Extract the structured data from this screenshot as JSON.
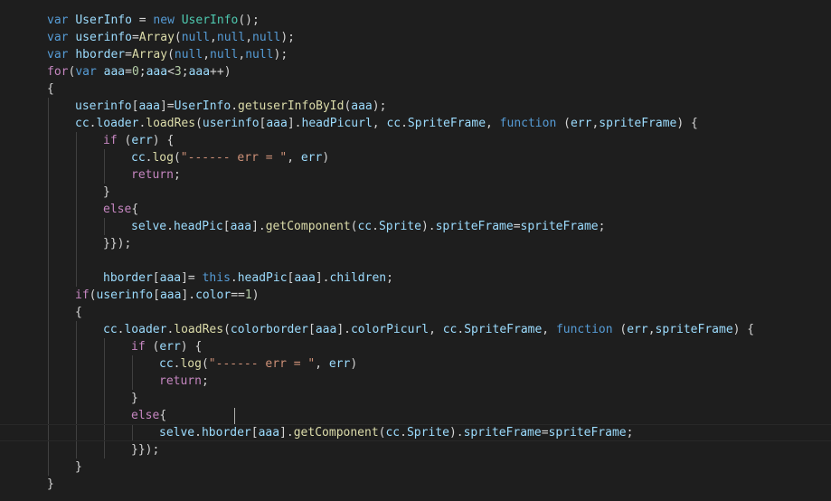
{
  "editor": {
    "theme_colors": {
      "background": "#1e1e1e",
      "keyword": "#569cd6",
      "control": "#c586c0",
      "variable": "#9cdcfe",
      "function": "#dcdcaa",
      "class": "#4ec9b0",
      "string": "#ce9178",
      "number": "#b5cea8",
      "punctuation": "#d4d4d4"
    },
    "cursor_line": 24,
    "lines": [
      {
        "indent": 0,
        "tokens": [
          [
            "kw",
            "var "
          ],
          [
            "vr",
            "UserInfo"
          ],
          [
            "pn",
            " = "
          ],
          [
            "kw",
            "new "
          ],
          [
            "cls",
            "UserInfo"
          ],
          [
            "pn",
            "();"
          ]
        ]
      },
      {
        "indent": 0,
        "tokens": [
          [
            "kw",
            "var "
          ],
          [
            "vr",
            "userinfo"
          ],
          [
            "pn",
            "="
          ],
          [
            "fn",
            "Array"
          ],
          [
            "pn",
            "("
          ],
          [
            "kw",
            "null"
          ],
          [
            "pn",
            ","
          ],
          [
            "kw",
            "null"
          ],
          [
            "pn",
            ","
          ],
          [
            "kw",
            "null"
          ],
          [
            "pn",
            ");"
          ]
        ]
      },
      {
        "indent": 0,
        "tokens": [
          [
            "kw",
            "var "
          ],
          [
            "vr",
            "hborder"
          ],
          [
            "pn",
            "="
          ],
          [
            "fn",
            "Array"
          ],
          [
            "pn",
            "("
          ],
          [
            "kw",
            "null"
          ],
          [
            "pn",
            ","
          ],
          [
            "kw",
            "null"
          ],
          [
            "pn",
            ","
          ],
          [
            "kw",
            "null"
          ],
          [
            "pn",
            ");"
          ]
        ]
      },
      {
        "indent": 0,
        "tokens": [
          [
            "ctl",
            "for"
          ],
          [
            "pn",
            "("
          ],
          [
            "kw",
            "var "
          ],
          [
            "vr",
            "aaa"
          ],
          [
            "pn",
            "="
          ],
          [
            "num",
            "0"
          ],
          [
            "pn",
            ";"
          ],
          [
            "vr",
            "aaa"
          ],
          [
            "pn",
            "<"
          ],
          [
            "num",
            "3"
          ],
          [
            "pn",
            ";"
          ],
          [
            "vr",
            "aaa"
          ],
          [
            "pn",
            "++)"
          ]
        ]
      },
      {
        "indent": 0,
        "tokens": [
          [
            "pn",
            "{"
          ]
        ]
      },
      {
        "indent": 1,
        "tokens": [
          [
            "vr",
            "userinfo"
          ],
          [
            "pn",
            "["
          ],
          [
            "vr",
            "aaa"
          ],
          [
            "pn",
            "]="
          ],
          [
            "vr",
            "UserInfo"
          ],
          [
            "pn",
            "."
          ],
          [
            "fn",
            "getuserInfoById"
          ],
          [
            "pn",
            "("
          ],
          [
            "vr",
            "aaa"
          ],
          [
            "pn",
            ");"
          ]
        ]
      },
      {
        "indent": 1,
        "tokens": [
          [
            "vr",
            "cc"
          ],
          [
            "pn",
            "."
          ],
          [
            "vr",
            "loader"
          ],
          [
            "pn",
            "."
          ],
          [
            "fn",
            "loadRes"
          ],
          [
            "pn",
            "("
          ],
          [
            "vr",
            "userinfo"
          ],
          [
            "pn",
            "["
          ],
          [
            "vr",
            "aaa"
          ],
          [
            "pn",
            "]."
          ],
          [
            "vr",
            "headPicurl"
          ],
          [
            "pn",
            ", "
          ],
          [
            "vr",
            "cc"
          ],
          [
            "pn",
            "."
          ],
          [
            "vr",
            "SpriteFrame"
          ],
          [
            "pn",
            ", "
          ],
          [
            "kw",
            "function"
          ],
          [
            "pn",
            " ("
          ],
          [
            "vr",
            "err"
          ],
          [
            "pn",
            ","
          ],
          [
            "vr",
            "spriteFrame"
          ],
          [
            "pn",
            ") {"
          ]
        ]
      },
      {
        "indent": 2,
        "tokens": [
          [
            "ctl",
            "if"
          ],
          [
            "pn",
            " ("
          ],
          [
            "vr",
            "err"
          ],
          [
            "pn",
            ") {"
          ]
        ]
      },
      {
        "indent": 3,
        "tokens": [
          [
            "vr",
            "cc"
          ],
          [
            "pn",
            "."
          ],
          [
            "fn",
            "log"
          ],
          [
            "pn",
            "("
          ],
          [
            "str",
            "\"------ err = \""
          ],
          [
            "pn",
            ", "
          ],
          [
            "vr",
            "err"
          ],
          [
            "pn",
            ")"
          ]
        ]
      },
      {
        "indent": 3,
        "tokens": [
          [
            "ctl",
            "return"
          ],
          [
            "pn",
            ";"
          ]
        ]
      },
      {
        "indent": 2,
        "tokens": [
          [
            "pn",
            "}"
          ]
        ]
      },
      {
        "indent": 2,
        "tokens": [
          [
            "ctl",
            "else"
          ],
          [
            "pn",
            "{"
          ]
        ]
      },
      {
        "indent": 3,
        "tokens": [
          [
            "vr",
            "selve"
          ],
          [
            "pn",
            "."
          ],
          [
            "vr",
            "headPic"
          ],
          [
            "pn",
            "["
          ],
          [
            "vr",
            "aaa"
          ],
          [
            "pn",
            "]."
          ],
          [
            "fn",
            "getComponent"
          ],
          [
            "pn",
            "("
          ],
          [
            "vr",
            "cc"
          ],
          [
            "pn",
            "."
          ],
          [
            "vr",
            "Sprite"
          ],
          [
            "pn",
            ")."
          ],
          [
            "vr",
            "spriteFrame"
          ],
          [
            "pn",
            "="
          ],
          [
            "vr",
            "spriteFrame"
          ],
          [
            "pn",
            ";"
          ]
        ]
      },
      {
        "indent": 2,
        "tokens": [
          [
            "pn",
            "}});"
          ]
        ]
      },
      {
        "indent": 0,
        "tokens": []
      },
      {
        "indent": 2,
        "tokens": [
          [
            "vr",
            "hborder"
          ],
          [
            "pn",
            "["
          ],
          [
            "vr",
            "aaa"
          ],
          [
            "pn",
            "]= "
          ],
          [
            "kw",
            "this"
          ],
          [
            "pn",
            "."
          ],
          [
            "vr",
            "headPic"
          ],
          [
            "pn",
            "["
          ],
          [
            "vr",
            "aaa"
          ],
          [
            "pn",
            "]."
          ],
          [
            "vr",
            "children"
          ],
          [
            "pn",
            ";"
          ]
        ]
      },
      {
        "indent": 1,
        "tokens": [
          [
            "ctl",
            "if"
          ],
          [
            "pn",
            "("
          ],
          [
            "vr",
            "userinfo"
          ],
          [
            "pn",
            "["
          ],
          [
            "vr",
            "aaa"
          ],
          [
            "pn",
            "]."
          ],
          [
            "vr",
            "color"
          ],
          [
            "pn",
            "=="
          ],
          [
            "num",
            "1"
          ],
          [
            "pn",
            ")"
          ]
        ]
      },
      {
        "indent": 1,
        "tokens": [
          [
            "pn",
            "{"
          ]
        ]
      },
      {
        "indent": 2,
        "tokens": [
          [
            "vr",
            "cc"
          ],
          [
            "pn",
            "."
          ],
          [
            "vr",
            "loader"
          ],
          [
            "pn",
            "."
          ],
          [
            "fn",
            "loadRes"
          ],
          [
            "pn",
            "("
          ],
          [
            "vr",
            "colorborder"
          ],
          [
            "pn",
            "["
          ],
          [
            "vr",
            "aaa"
          ],
          [
            "pn",
            "]."
          ],
          [
            "vr",
            "colorPicurl"
          ],
          [
            "pn",
            ", "
          ],
          [
            "vr",
            "cc"
          ],
          [
            "pn",
            "."
          ],
          [
            "vr",
            "SpriteFrame"
          ],
          [
            "pn",
            ", "
          ],
          [
            "kw",
            "function"
          ],
          [
            "pn",
            " ("
          ],
          [
            "vr",
            "err"
          ],
          [
            "pn",
            ","
          ],
          [
            "vr",
            "spriteFrame"
          ],
          [
            "pn",
            ") {"
          ]
        ]
      },
      {
        "indent": 3,
        "tokens": [
          [
            "ctl",
            "if"
          ],
          [
            "pn",
            " ("
          ],
          [
            "vr",
            "err"
          ],
          [
            "pn",
            ") {"
          ]
        ]
      },
      {
        "indent": 4,
        "tokens": [
          [
            "vr",
            "cc"
          ],
          [
            "pn",
            "."
          ],
          [
            "fn",
            "log"
          ],
          [
            "pn",
            "("
          ],
          [
            "str",
            "\"------ err = \""
          ],
          [
            "pn",
            ", "
          ],
          [
            "vr",
            "err"
          ],
          [
            "pn",
            ")"
          ]
        ]
      },
      {
        "indent": 4,
        "tokens": [
          [
            "ctl",
            "return"
          ],
          [
            "pn",
            ";"
          ]
        ]
      },
      {
        "indent": 3,
        "tokens": [
          [
            "pn",
            "}"
          ]
        ]
      },
      {
        "indent": 3,
        "tokens": [
          [
            "ctl",
            "else"
          ],
          [
            "pn",
            "{"
          ]
        ]
      },
      {
        "indent": 4,
        "tokens": [
          [
            "vr",
            "selve"
          ],
          [
            "pn",
            "."
          ],
          [
            "vr",
            "hborder"
          ],
          [
            "pn",
            "["
          ],
          [
            "vr",
            "aaa"
          ],
          [
            "pn",
            "]."
          ],
          [
            "fn",
            "getComponent"
          ],
          [
            "pn",
            "("
          ],
          [
            "vr",
            "cc"
          ],
          [
            "pn",
            "."
          ],
          [
            "vr",
            "Sprite"
          ],
          [
            "pn",
            ")."
          ],
          [
            "vr",
            "spriteFrame"
          ],
          [
            "pn",
            "="
          ],
          [
            "vr",
            "spriteFrame"
          ],
          [
            "pn",
            ";"
          ]
        ]
      },
      {
        "indent": 3,
        "tokens": [
          [
            "pn",
            "}});"
          ]
        ]
      },
      {
        "indent": 1,
        "tokens": [
          [
            "pn",
            "}"
          ]
        ]
      },
      {
        "indent": 0,
        "tokens": [
          [
            "pn",
            "}"
          ]
        ]
      }
    ]
  }
}
